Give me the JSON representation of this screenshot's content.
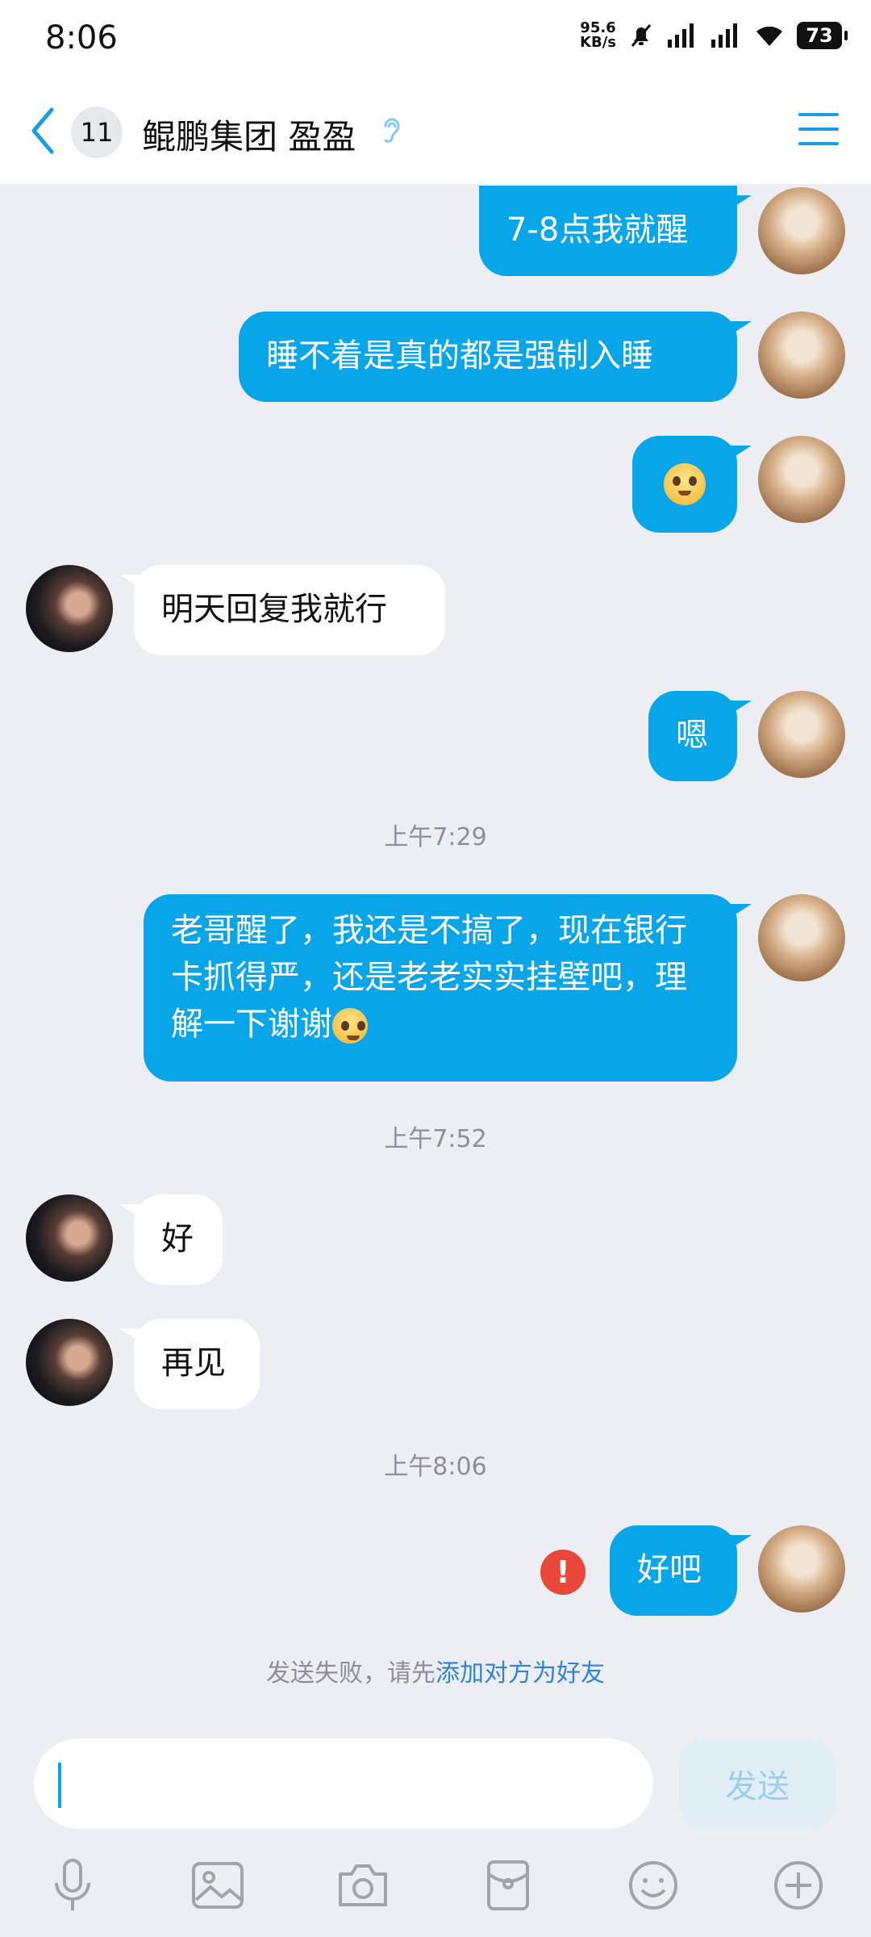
{
  "status_bar": {
    "time": "8:06",
    "net_speed_top": "95.6",
    "net_speed_bottom": "KB/s",
    "battery": "73"
  },
  "header": {
    "unread_count": "11",
    "title": "鲲鹏集团 盈盈"
  },
  "colors": {
    "accent": "#08A6E8",
    "error": "#E9473A",
    "link": "#2F84D8"
  },
  "messages": [
    {
      "from": "self",
      "text": "7-8点我就醒"
    },
    {
      "from": "self",
      "text": "睡不着是真的都是强制入睡"
    },
    {
      "from": "self",
      "emoji": "pleading-face"
    },
    {
      "from": "other",
      "text": "明天回复我就行"
    },
    {
      "from": "self",
      "text": "嗯"
    },
    {
      "from": "self",
      "text": "老哥醒了，我还是不搞了，现在银行卡抓得严，还是老老实实挂壁吧，理解一下谢谢"
    },
    {
      "from": "other",
      "text": "好"
    },
    {
      "from": "other",
      "text": "再见"
    },
    {
      "from": "self",
      "text": "好吧",
      "status": "failed"
    }
  ],
  "timestamps": [
    "上午7:29",
    "上午7:52",
    "上午8:06"
  ],
  "failure_notice": {
    "prefix": "发送失败，请先",
    "link": "添加对方为好友"
  },
  "input": {
    "value": "",
    "send_label": "发送"
  },
  "toolbar": [
    "microphone-icon",
    "image-icon",
    "camera-icon",
    "red-packet-icon",
    "emoji-icon",
    "plus-icon"
  ]
}
